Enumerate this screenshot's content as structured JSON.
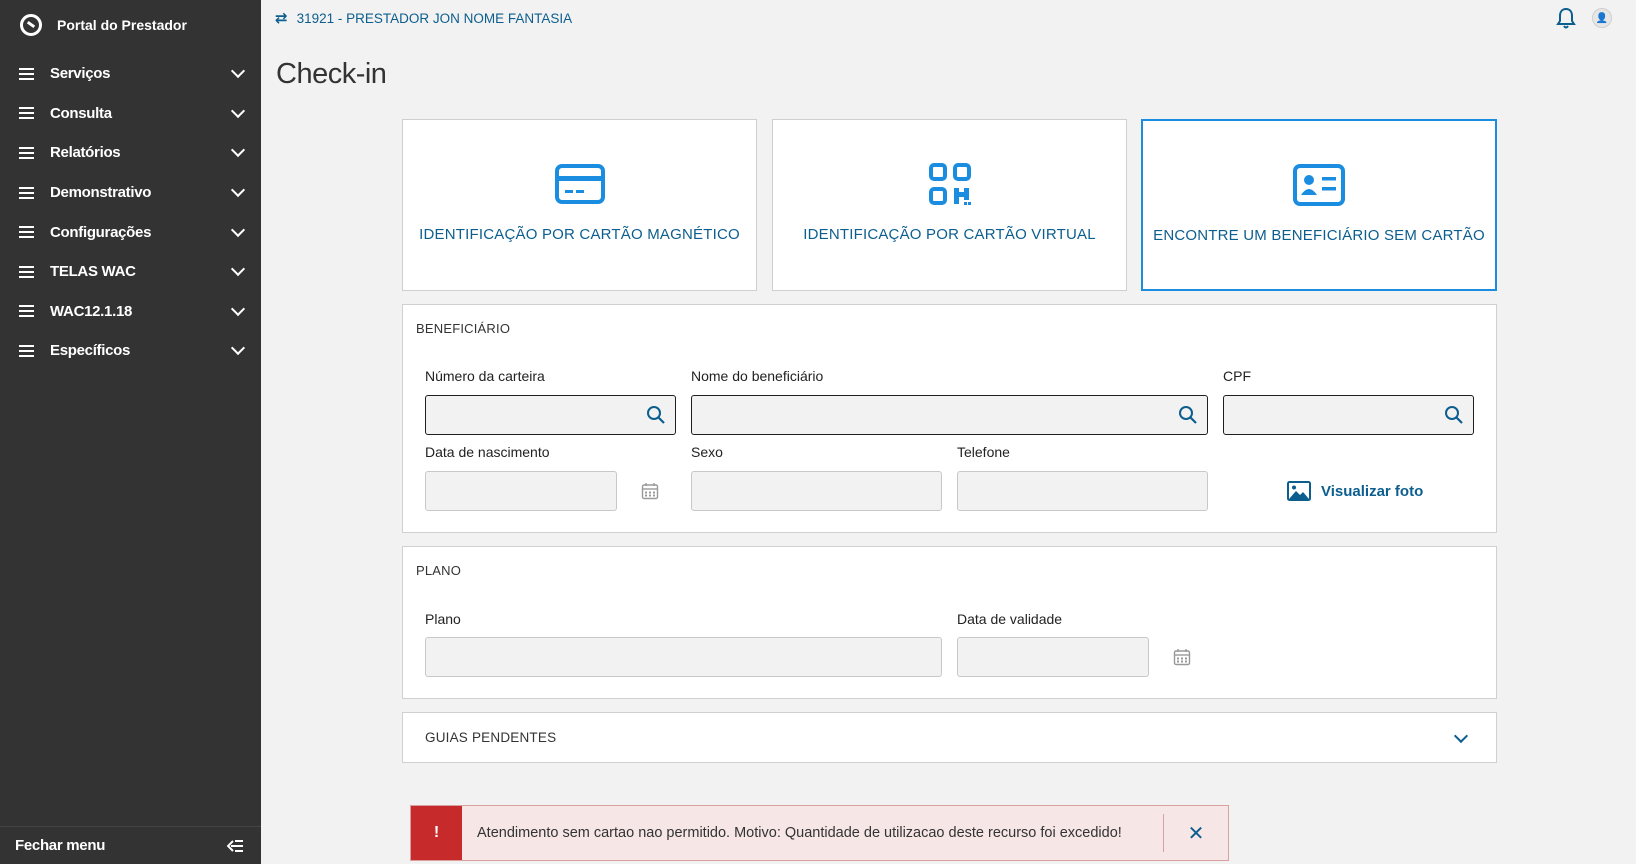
{
  "sidebar": {
    "brand": "Portal do Prestador",
    "items": [
      {
        "label": "Serviços"
      },
      {
        "label": "Consulta"
      },
      {
        "label": "Relatórios"
      },
      {
        "label": "Demonstrativo"
      },
      {
        "label": "Configurações"
      },
      {
        "label": "TELAS WAC"
      },
      {
        "label": "WAC12.1.18"
      },
      {
        "label": "Específicos"
      }
    ],
    "close_label": "Fechar menu"
  },
  "topbar": {
    "provider": "31921 - PRESTADOR JON NOME FANTASIA"
  },
  "page": {
    "title": "Check-in"
  },
  "cards": [
    {
      "label": "IDENTIFICAÇÃO POR CARTÃO MAGNÉTICO",
      "icon": "credit-card-icon"
    },
    {
      "label": "IDENTIFICAÇÃO POR CARTÃO VIRTUAL",
      "icon": "qr-code-icon"
    },
    {
      "label": "ENCONTRE UM BENEFICIÁRIO SEM CARTÃO",
      "icon": "id-card-icon",
      "selected": true
    }
  ],
  "beneficiario": {
    "title": "BENEFICIÁRIO",
    "fields": {
      "carteira": {
        "label": "Número da carteira",
        "value": ""
      },
      "nome": {
        "label": "Nome do beneficiário",
        "value": ""
      },
      "cpf": {
        "label": "CPF",
        "value": ""
      },
      "nascimento": {
        "label": "Data de nascimento",
        "value": ""
      },
      "sexo": {
        "label": "Sexo",
        "value": ""
      },
      "telefone": {
        "label": "Telefone",
        "value": ""
      }
    },
    "photo_link": "Visualizar foto"
  },
  "plano": {
    "title": "PLANO",
    "fields": {
      "plano": {
        "label": "Plano",
        "value": ""
      },
      "validade": {
        "label": "Data de validade",
        "value": ""
      }
    }
  },
  "guias": {
    "title": "GUIAS PENDENTES"
  },
  "toast": {
    "badge": "!",
    "message": "Atendimento sem cartao nao permitido. Motivo: Quantidade de utilizacao deste recurso foi excedido!",
    "close": "✕"
  },
  "colors": {
    "sidebar": "#333333",
    "accent": "#0c5e8f",
    "icon_blue": "#1b8de0",
    "error": "#c62a2a"
  }
}
